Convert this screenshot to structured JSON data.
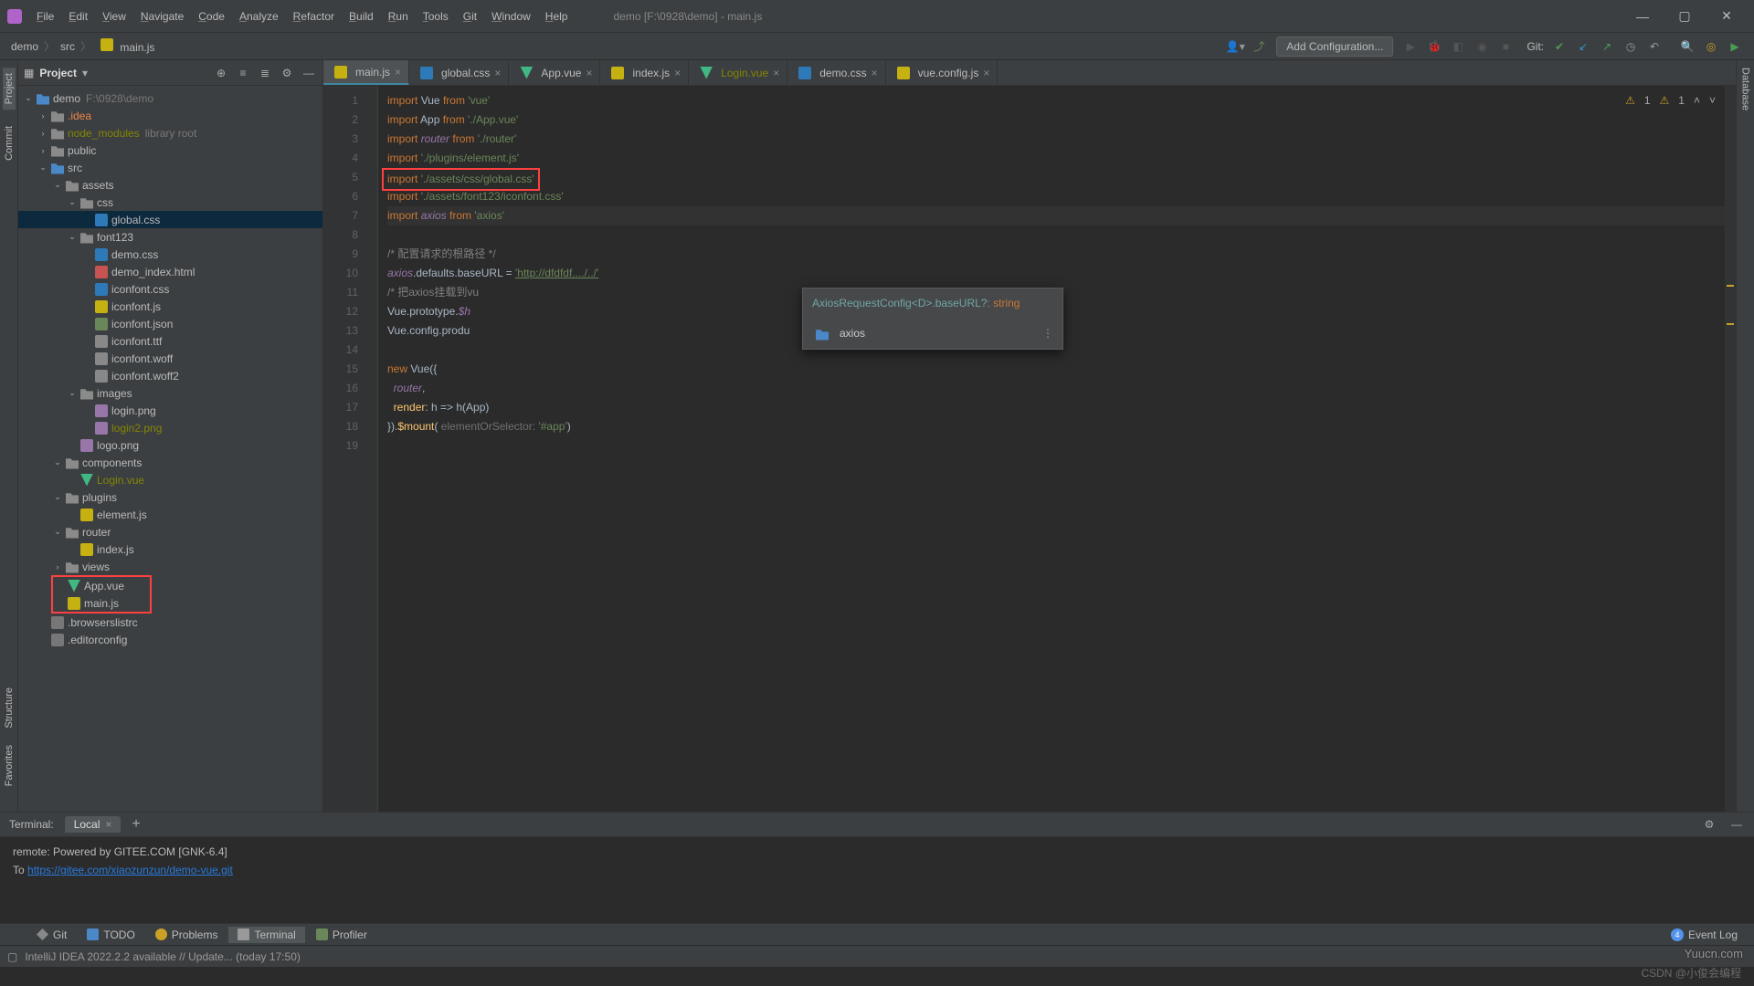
{
  "window_title": "demo [F:\\0928\\demo] - main.js",
  "menu": [
    "File",
    "Edit",
    "View",
    "Navigate",
    "Code",
    "Analyze",
    "Refactor",
    "Build",
    "Run",
    "Tools",
    "Git",
    "Window",
    "Help"
  ],
  "breadcrumb": [
    "demo",
    "src",
    "main.js"
  ],
  "run_config": "Add Configuration...",
  "git_label": "Git:",
  "project": {
    "title": "Project",
    "root": {
      "name": "demo",
      "hint": "F:\\0928\\demo"
    },
    "tree": [
      {
        "d": 1,
        "exp": true,
        "icon": "folder-blue",
        "label": "demo",
        "hint": "F:\\0928\\demo"
      },
      {
        "d": 2,
        "exp": false,
        "icon": "folder",
        "label": ".idea",
        "cls": "dim"
      },
      {
        "d": 2,
        "exp": false,
        "icon": "folder",
        "label": "node_modules",
        "cls": "exc",
        "suffix": "library root"
      },
      {
        "d": 2,
        "exp": false,
        "icon": "folder",
        "label": "public"
      },
      {
        "d": 2,
        "exp": true,
        "icon": "folder-blue",
        "label": "src"
      },
      {
        "d": 3,
        "exp": true,
        "icon": "folder",
        "label": "assets"
      },
      {
        "d": 4,
        "exp": true,
        "icon": "folder",
        "label": "css"
      },
      {
        "d": 5,
        "icon": "css",
        "label": "global.css",
        "selected": true
      },
      {
        "d": 4,
        "exp": true,
        "icon": "folder",
        "label": "font123"
      },
      {
        "d": 5,
        "icon": "css",
        "label": "demo.css"
      },
      {
        "d": 5,
        "icon": "html",
        "label": "demo_index.html"
      },
      {
        "d": 5,
        "icon": "css",
        "label": "iconfont.css"
      },
      {
        "d": 5,
        "icon": "js",
        "label": "iconfont.js"
      },
      {
        "d": 5,
        "icon": "json",
        "label": "iconfont.json"
      },
      {
        "d": 5,
        "icon": "font",
        "label": "iconfont.ttf"
      },
      {
        "d": 5,
        "icon": "font",
        "label": "iconfont.woff"
      },
      {
        "d": 5,
        "icon": "font",
        "label": "iconfont.woff2"
      },
      {
        "d": 4,
        "exp": true,
        "icon": "folder",
        "label": "images"
      },
      {
        "d": 5,
        "icon": "img",
        "label": "login.png"
      },
      {
        "d": 5,
        "icon": "img",
        "label": "login2.png",
        "cls": "exc"
      },
      {
        "d": 4,
        "icon": "img",
        "label": "logo.png"
      },
      {
        "d": 3,
        "exp": true,
        "icon": "folder",
        "label": "components"
      },
      {
        "d": 4,
        "icon": "vue",
        "label": "Login.vue",
        "cls": "exc"
      },
      {
        "d": 3,
        "exp": true,
        "icon": "folder",
        "label": "plugins"
      },
      {
        "d": 4,
        "icon": "js",
        "label": "element.js"
      },
      {
        "d": 3,
        "exp": true,
        "icon": "folder",
        "label": "router"
      },
      {
        "d": 4,
        "icon": "js",
        "label": "index.js"
      },
      {
        "d": 3,
        "exp": false,
        "icon": "folder",
        "label": "views"
      },
      {
        "d": 3,
        "icon": "vue",
        "label": "App.vue",
        "boxed": "top"
      },
      {
        "d": 3,
        "icon": "js",
        "label": "main.js",
        "boxed": "bottom"
      },
      {
        "d": 2,
        "icon": "file",
        "label": ".browserslistrc"
      },
      {
        "d": 2,
        "icon": "file",
        "label": ".editorconfig"
      }
    ]
  },
  "tabs": [
    {
      "icon": "js",
      "label": "main.js",
      "active": true
    },
    {
      "icon": "css",
      "label": "global.css"
    },
    {
      "icon": "vue",
      "label": "App.vue"
    },
    {
      "icon": "js",
      "label": "index.js"
    },
    {
      "icon": "vue",
      "label": "Login.vue",
      "cls": "exc"
    },
    {
      "icon": "css",
      "label": "demo.css"
    },
    {
      "icon": "js",
      "label": "vue.config.js"
    }
  ],
  "inspections": {
    "warn1": "1",
    "warn2": "1"
  },
  "code": {
    "lines": [
      {
        "n": 1,
        "seg": [
          [
            "kw",
            "import "
          ],
          [
            "",
            "Vue "
          ],
          [
            "kw",
            "from "
          ],
          [
            "str",
            "'vue'"
          ]
        ]
      },
      {
        "n": 2,
        "seg": [
          [
            "kw",
            "import "
          ],
          [
            "",
            "App "
          ],
          [
            "kw",
            "from "
          ],
          [
            "str",
            "'./App.vue'"
          ]
        ]
      },
      {
        "n": 3,
        "seg": [
          [
            "kw",
            "import "
          ],
          [
            "ident",
            "router"
          ],
          [
            "",
            " "
          ],
          [
            "kw",
            "from "
          ],
          [
            "str",
            "'./router'"
          ]
        ]
      },
      {
        "n": 4,
        "seg": [
          [
            "kw",
            "import "
          ],
          [
            "str",
            "'./plugins/element.js'"
          ]
        ]
      },
      {
        "n": 5,
        "boxed": true,
        "seg": [
          [
            "kw",
            "import "
          ],
          [
            "str",
            "'./assets/css/global.css'"
          ]
        ]
      },
      {
        "n": 6,
        "seg": [
          [
            "kw",
            "import "
          ],
          [
            "str",
            "'./assets/font123/iconfont.css'"
          ]
        ]
      },
      {
        "n": 7,
        "hl": true,
        "seg": [
          [
            "kw",
            "import "
          ],
          [
            "ident",
            "axios"
          ],
          [
            "",
            " "
          ],
          [
            "kw",
            "from "
          ],
          [
            "str",
            "'axios'"
          ]
        ]
      },
      {
        "n": 8,
        "seg": []
      },
      {
        "n": 9,
        "seg": [
          [
            "cmt",
            "/* 配置请求的根路径 */"
          ]
        ]
      },
      {
        "n": 10,
        "seg": [
          [
            "ident",
            "axios"
          ],
          [
            "",
            ".defaults.baseURL = "
          ],
          [
            "str underl",
            "'http://dfdfdf..../../'"
          ]
        ]
      },
      {
        "n": 11,
        "seg": [
          [
            "cmt",
            "/* 把axios挂载到vu"
          ]
        ]
      },
      {
        "n": 12,
        "seg": [
          [
            "",
            "Vue.prototype."
          ],
          [
            "ident",
            "$h"
          ]
        ]
      },
      {
        "n": 13,
        "seg": [
          [
            "",
            "Vue.config.produ"
          ]
        ]
      },
      {
        "n": 14,
        "seg": []
      },
      {
        "n": 15,
        "seg": [
          [
            "kw",
            "new "
          ],
          [
            "",
            "Vue({"
          ]
        ]
      },
      {
        "n": 16,
        "seg": [
          [
            "",
            "  "
          ],
          [
            "ident",
            "router"
          ],
          [
            "",
            ","
          ]
        ]
      },
      {
        "n": 17,
        "seg": [
          [
            "",
            "  "
          ],
          [
            "fn",
            "render"
          ],
          [
            "",
            ": h => h(App)"
          ]
        ]
      },
      {
        "n": 18,
        "seg": [
          [
            "",
            "})."
          ],
          [
            "fn",
            "$mount"
          ],
          [
            "",
            "( "
          ],
          [
            "param",
            "elementOrSelector: "
          ],
          [
            "str",
            "'#app'"
          ],
          [
            "",
            ")"
          ]
        ]
      },
      {
        "n": 19,
        "seg": []
      }
    ]
  },
  "popup": {
    "hint_a": "AxiosRequestConfig<D>.",
    "hint_b": "baseURL?",
    "hint_c": ": ",
    "hint_d": "string",
    "option": "axios"
  },
  "terminal": {
    "title": "Terminal:",
    "tab": "Local",
    "line1": "remote: Powered by GITEE.COM [GNK-6.4]",
    "line2_a": "To ",
    "line2_b": "https://gitee.com/xiaozunzun/demo-vue.git"
  },
  "bottom_tools": {
    "git": "Git",
    "todo": "TODO",
    "problems": "Problems",
    "terminal": "Terminal",
    "profiler": "Profiler",
    "event_log": "Event Log",
    "badge": "4"
  },
  "status": "IntelliJ IDEA 2022.2.2 available // Update... (today 17:50)",
  "left_tools": {
    "project": "Project",
    "commit": "Commit",
    "favorites": "Favorites",
    "structure": "Structure"
  },
  "right_tools": {
    "database": "Database"
  },
  "watermark": "Yuucn.com",
  "csdn": "CSDN @小俊会编程"
}
